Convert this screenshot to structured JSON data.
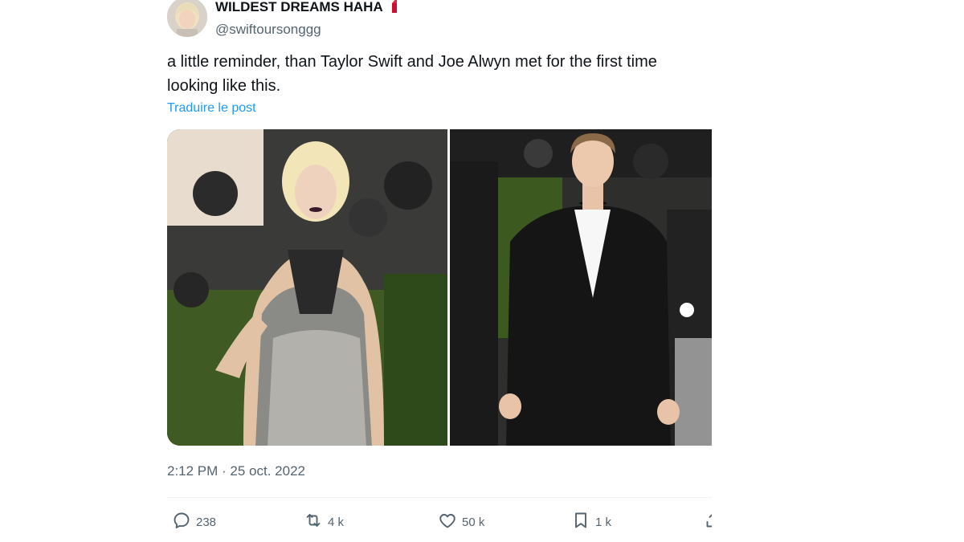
{
  "author": {
    "display_name": "WILDEST DREAMS HAHA",
    "handle": "@swiftoursonggg",
    "emoji_icon": "red-lipstick-icon"
  },
  "tweet": {
    "text": "a little reminder, than Taylor Swift and Joe Alwyn met for the first time looking like this.",
    "translate_label": "Traduire le post",
    "timestamp": "2:12 PM · 25 oct. 2022"
  },
  "actions": {
    "replies": "238",
    "reposts": "4 k",
    "likes": "50 k",
    "bookmarks": "1 k"
  },
  "colors": {
    "link": "#1d9bf0",
    "secondary_text": "#536471",
    "primary_text": "#0f1419"
  }
}
